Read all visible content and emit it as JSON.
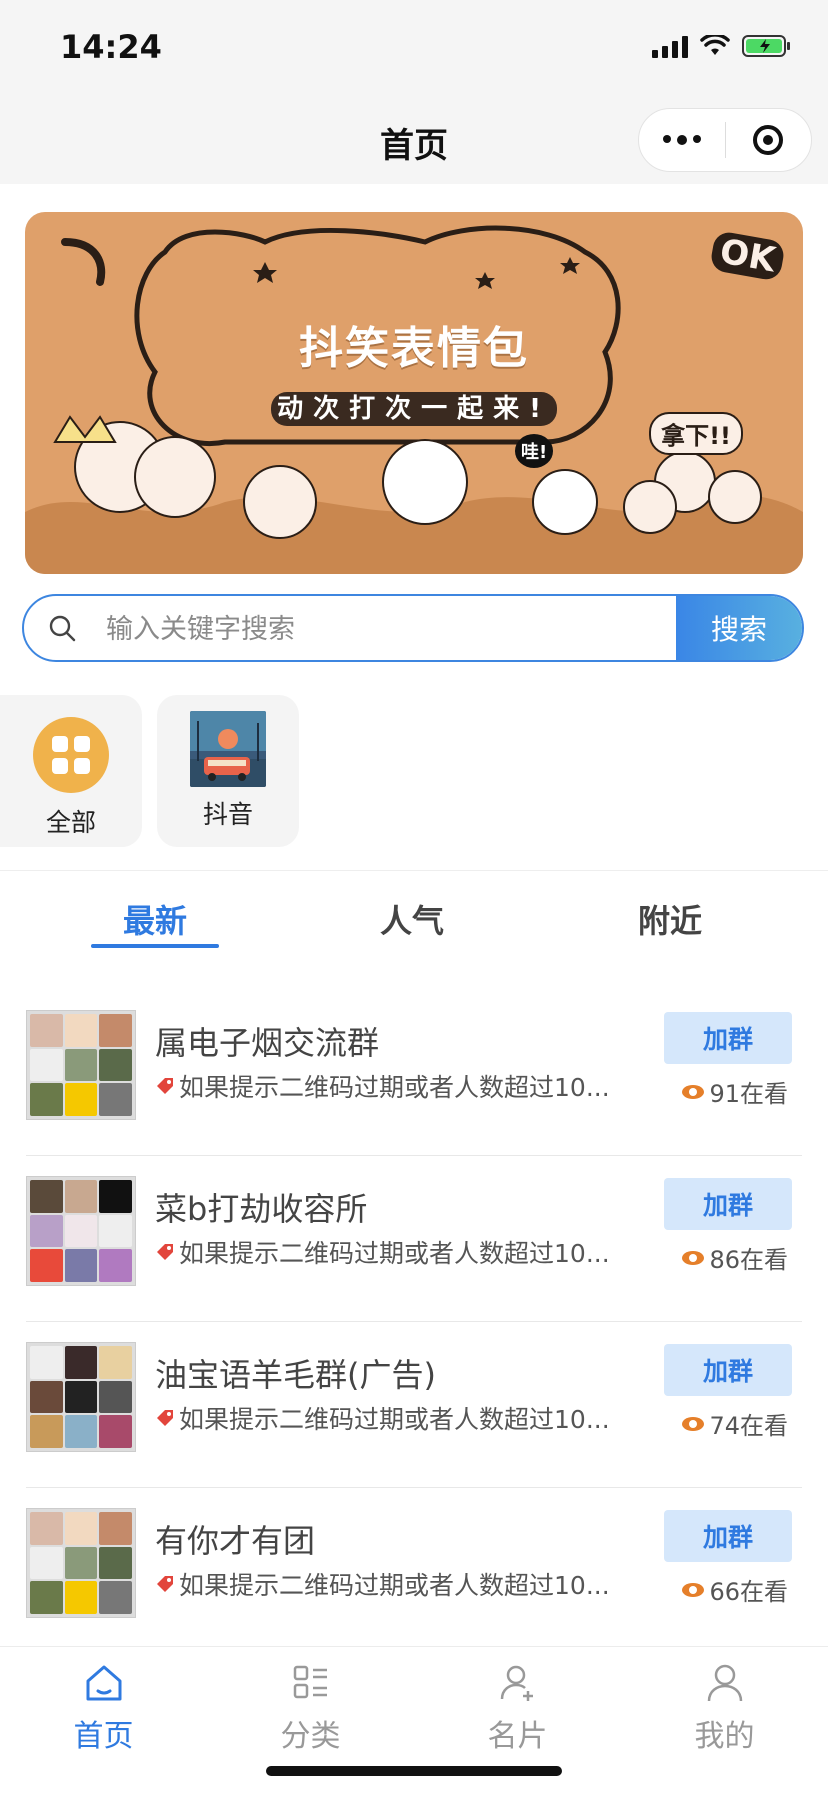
{
  "status_bar": {
    "time": "14:24"
  },
  "navbar": {
    "title": "首页"
  },
  "banner": {
    "title": "抖笑表情包",
    "subtitle": "动次打次一起来!",
    "badge_ok": "OK",
    "badge_wa": "哇!",
    "badge_na": "拿下!!"
  },
  "search": {
    "placeholder": "输入关键字搜索",
    "button_label": "搜索"
  },
  "categories": [
    {
      "label": "全部",
      "icon": "grid-icon"
    },
    {
      "label": "抖音",
      "icon": "douyin-thumbnail"
    }
  ],
  "tabs": [
    {
      "label": "最新",
      "active": true
    },
    {
      "label": "人气",
      "active": false
    },
    {
      "label": "附近",
      "active": false
    }
  ],
  "groups": [
    {
      "name": "属电子烟交流群",
      "desc": "如果提示二维码过期或者人数超过10...",
      "join_label": "加群",
      "views": "91在看"
    },
    {
      "name": "菜b打劫收容所",
      "desc": "如果提示二维码过期或者人数超过10...",
      "join_label": "加群",
      "views": "86在看"
    },
    {
      "name": "油宝语羊毛群(广告)",
      "desc": "如果提示二维码过期或者人数超过10...",
      "join_label": "加群",
      "views": "74在看"
    },
    {
      "name": "有你才有团",
      "desc": "如果提示二维码过期或者人数超过10...",
      "join_label": "加群",
      "views": "66在看"
    }
  ],
  "tabbar": [
    {
      "label": "首页",
      "icon": "home-icon",
      "active": true
    },
    {
      "label": "分类",
      "icon": "category-icon",
      "active": false
    },
    {
      "label": "名片",
      "icon": "add-user-icon",
      "active": false
    },
    {
      "label": "我的",
      "icon": "user-icon",
      "active": false
    }
  ],
  "colors": {
    "accent": "#2f7ae0",
    "banner_bg": "#dfa06a",
    "join_bg": "#d5e7fb",
    "category_all": "#f0b24b"
  }
}
